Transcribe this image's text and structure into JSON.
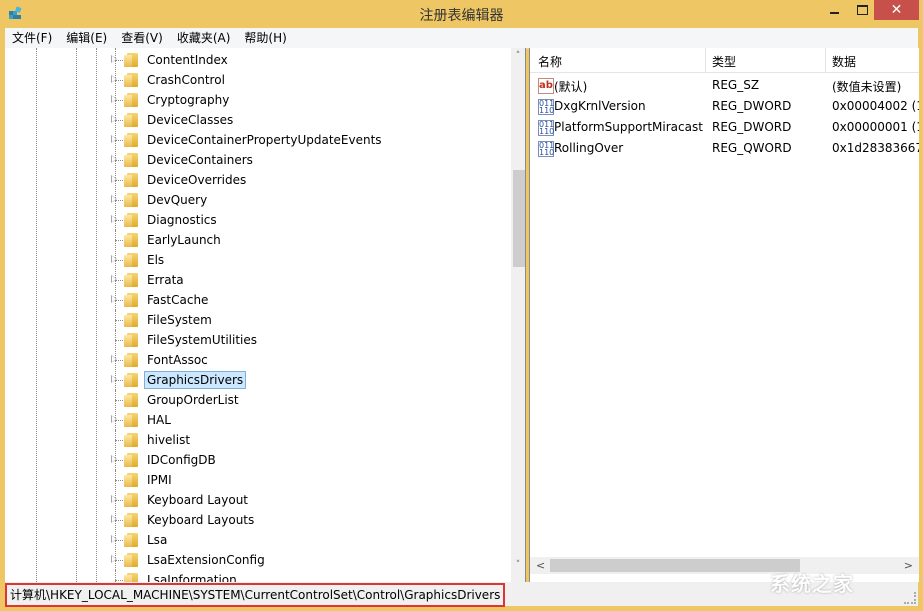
{
  "window": {
    "title": "注册表编辑器",
    "app_icon": "regedit-icon",
    "controls": {
      "minimize": "minimize-icon",
      "maximize": "maximize-icon",
      "close": "✕"
    }
  },
  "menu": [
    {
      "label": "文件(F)"
    },
    {
      "label": "编辑(E)"
    },
    {
      "label": "查看(V)"
    },
    {
      "label": "收藏夹(A)"
    },
    {
      "label": "帮助(H)"
    }
  ],
  "tree": {
    "items": [
      {
        "label": "ContentIndex",
        "expandable": true,
        "selected": false
      },
      {
        "label": "CrashControl",
        "expandable": true,
        "selected": false
      },
      {
        "label": "Cryptography",
        "expandable": true,
        "selected": false
      },
      {
        "label": "DeviceClasses",
        "expandable": true,
        "selected": false
      },
      {
        "label": "DeviceContainerPropertyUpdateEvents",
        "expandable": true,
        "selected": false
      },
      {
        "label": "DeviceContainers",
        "expandable": true,
        "selected": false
      },
      {
        "label": "DeviceOverrides",
        "expandable": true,
        "selected": false
      },
      {
        "label": "DevQuery",
        "expandable": true,
        "selected": false
      },
      {
        "label": "Diagnostics",
        "expandable": true,
        "selected": false
      },
      {
        "label": "EarlyLaunch",
        "expandable": false,
        "selected": false
      },
      {
        "label": "Els",
        "expandable": true,
        "selected": false
      },
      {
        "label": "Errata",
        "expandable": true,
        "selected": false
      },
      {
        "label": "FastCache",
        "expandable": true,
        "selected": false
      },
      {
        "label": "FileSystem",
        "expandable": false,
        "selected": false
      },
      {
        "label": "FileSystemUtilities",
        "expandable": false,
        "selected": false
      },
      {
        "label": "FontAssoc",
        "expandable": true,
        "selected": false
      },
      {
        "label": "GraphicsDrivers",
        "expandable": true,
        "selected": true
      },
      {
        "label": "GroupOrderList",
        "expandable": false,
        "selected": false
      },
      {
        "label": "HAL",
        "expandable": true,
        "selected": false
      },
      {
        "label": "hivelist",
        "expandable": false,
        "selected": false
      },
      {
        "label": "IDConfigDB",
        "expandable": true,
        "selected": false
      },
      {
        "label": "IPMI",
        "expandable": false,
        "selected": false
      },
      {
        "label": "Keyboard Layout",
        "expandable": true,
        "selected": false
      },
      {
        "label": "Keyboard Layouts",
        "expandable": true,
        "selected": false
      },
      {
        "label": "Lsa",
        "expandable": true,
        "selected": false
      },
      {
        "label": "LsaExtensionConfig",
        "expandable": true,
        "selected": false
      },
      {
        "label": "LsaInformation",
        "expandable": false,
        "selected": false
      }
    ]
  },
  "values": {
    "columns": {
      "name": "名称",
      "type": "类型",
      "data": "数据"
    },
    "rows": [
      {
        "icon": "string-value-icon",
        "icon_text": "ab",
        "name": "(默认)",
        "type": "REG_SZ",
        "data": "(数值未设置)"
      },
      {
        "icon": "binary-value-icon",
        "icon_text": "011 110",
        "name": "DxgKrnlVersion",
        "type": "REG_DWORD",
        "data": "0x00004002 (1"
      },
      {
        "icon": "binary-value-icon",
        "icon_text": "011 110",
        "name": "PlatformSupportMiracast",
        "type": "REG_DWORD",
        "data": "0x00000001 (1"
      },
      {
        "icon": "binary-value-icon",
        "icon_text": "011 110",
        "name": "RollingOver",
        "type": "REG_QWORD",
        "data": "0x1d28383667"
      }
    ]
  },
  "scroll": {
    "up": "˄",
    "down": "˅",
    "left": "<",
    "right": ">"
  },
  "status": {
    "path": "计算机\\HKEY_LOCAL_MACHINE\\SYSTEM\\CurrentControlSet\\Control\\GraphicsDrivers",
    "highlight_color": "#e03434"
  },
  "watermark": "系统之家",
  "colors": {
    "titlebar": "#eec764",
    "close_button": "#c7504b",
    "selection_bg": "#cce8ff",
    "selection_border": "#7dafdf"
  }
}
